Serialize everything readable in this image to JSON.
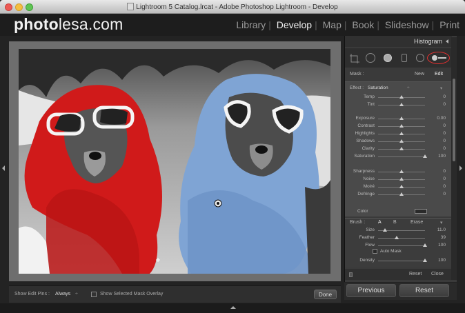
{
  "window": {
    "title": "Lightroom 5 Catalog.lrcat - Adobe Photoshop Lightroom - Develop"
  },
  "logo": {
    "bold": "photo",
    "light": "lesa.com"
  },
  "modules": [
    "Library",
    "Develop",
    "Map",
    "Book",
    "Slideshow",
    "Print"
  ],
  "active_module": "Develop",
  "panel": {
    "histogram_label": "Histogram",
    "mask_label": "Mask :",
    "new_label": "New",
    "edit_label": "Edit",
    "effect_label": "Effect :",
    "effect_value": "Saturation",
    "sliders": [
      {
        "name": "Temp",
        "value": "0",
        "pos": 0.5
      },
      {
        "name": "Tint",
        "value": "0",
        "pos": 0.5
      },
      {
        "name": "Exposure",
        "value": "0.00",
        "pos": 0.5
      },
      {
        "name": "Contrast",
        "value": "0",
        "pos": 0.5
      },
      {
        "name": "Highlights",
        "value": "0",
        "pos": 0.5
      },
      {
        "name": "Shadows",
        "value": "0",
        "pos": 0.5
      },
      {
        "name": "Clarity",
        "value": "0",
        "pos": 0.5
      },
      {
        "name": "Saturation",
        "value": "100",
        "pos": 1.0
      },
      {
        "name": "Sharpness",
        "value": "0",
        "pos": 0.5
      },
      {
        "name": "Noise",
        "value": "0",
        "pos": 0.5
      },
      {
        "name": "Moiré",
        "value": "0",
        "pos": 0.5
      },
      {
        "name": "Defringe",
        "value": "0",
        "pos": 0.5
      }
    ],
    "color_label": "Color",
    "brush_label": "Brush :",
    "brush_a": "A",
    "brush_b": "B",
    "erase_label": "Erase",
    "brush_sliders": [
      {
        "name": "Size",
        "value": "11.0",
        "pos": 0.15
      },
      {
        "name": "Feather",
        "value": "39",
        "pos": 0.39
      },
      {
        "name": "Flow",
        "value": "100",
        "pos": 1.0
      }
    ],
    "auto_mask_label": "Auto Mask",
    "density": {
      "name": "Density",
      "value": "100",
      "pos": 1.0
    },
    "reset_label": "Reset",
    "close_label": "Close"
  },
  "toolbar": {
    "show_edit_pins_label": "Show Edit Pins :",
    "show_edit_pins_value": "Always",
    "overlay_label": "Show Selected Mask Overlay",
    "done_label": "Done"
  },
  "buttons": {
    "previous": "Previous",
    "reset": "Reset"
  },
  "colors": {
    "scarf_red": "#d01a1a",
    "scarf_blue": "#7fa4d4",
    "accent_highlight": "#e03030"
  }
}
